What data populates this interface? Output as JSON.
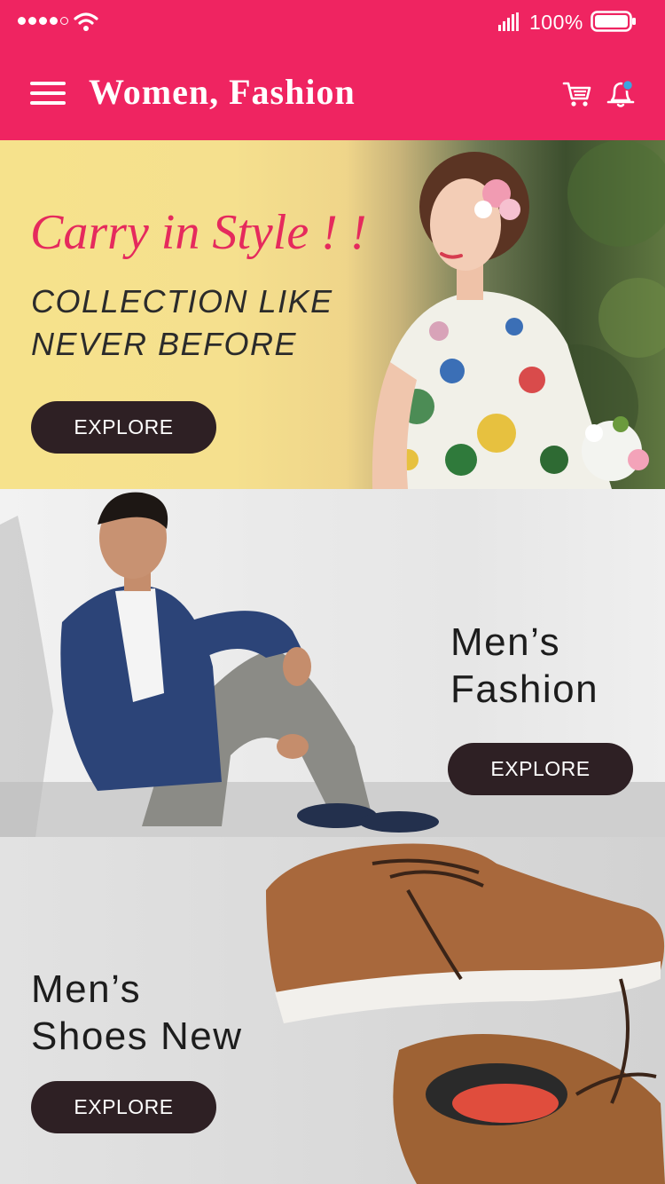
{
  "status_bar": {
    "battery_percent": "100%",
    "signal_dots_filled": 4,
    "signal_dots_total": 5
  },
  "app_bar": {
    "title": "Women, Fashion",
    "background_color": "#ef2461",
    "icons": [
      "menu-icon",
      "cart-icon",
      "bell-icon"
    ]
  },
  "banners": {
    "women": {
      "tagline": "Carry in Style ! !",
      "headline_line1": "COLLECTION LIKE",
      "headline_line2": "NEVER BEFORE",
      "button_label": "EXPLORE"
    },
    "men": {
      "title_line1": "Men’s",
      "title_line2": "Fashion",
      "button_label": "EXPLORE"
    },
    "shoes": {
      "title_line1": "Men’s",
      "title_line2": "Shoes New",
      "button_label": "EXPLORE"
    }
  },
  "colors": {
    "accent": "#ef2461",
    "button": "#2e2024",
    "script_title": "#e52a5d"
  }
}
